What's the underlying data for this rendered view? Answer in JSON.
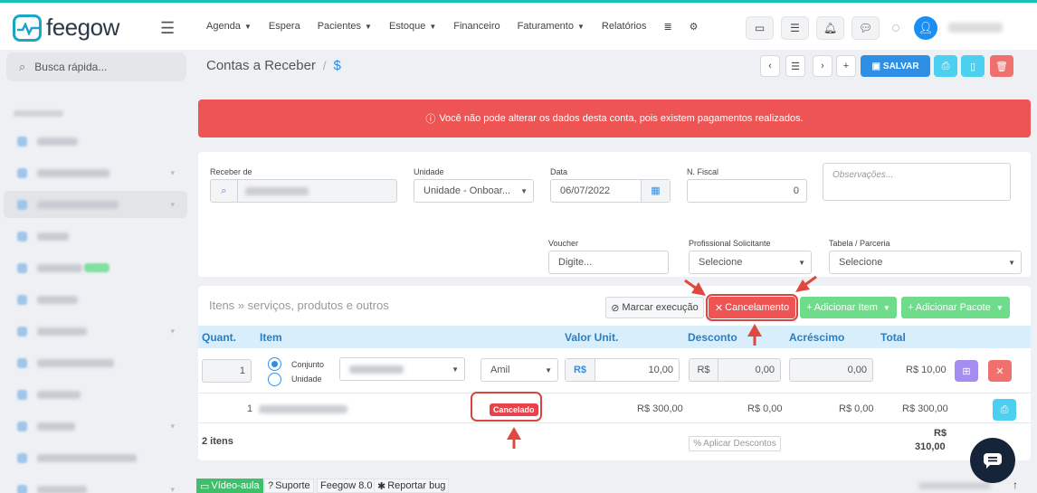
{
  "app": {
    "brand": "feegow"
  },
  "nav": [
    {
      "label": "Agenda",
      "dropdown": true
    },
    {
      "label": "Espera",
      "dropdown": false
    },
    {
      "label": "Pacientes",
      "dropdown": true
    },
    {
      "label": "Estoque",
      "dropdown": true
    },
    {
      "label": "Financeiro",
      "dropdown": false
    },
    {
      "label": "Faturamento",
      "dropdown": true
    },
    {
      "label": "Relatórios",
      "dropdown": false
    }
  ],
  "search": {
    "placeholder": "Busca rápida..."
  },
  "page": {
    "title": "Contas a Receber",
    "separator": "/",
    "symbol": "$",
    "save_label": "SALVAR"
  },
  "alert": {
    "message": "Você não pode alterar os dados desta conta, pois existem pagamentos realizados."
  },
  "form": {
    "receber_de": {
      "label": "Receber de"
    },
    "unidade": {
      "label": "Unidade",
      "value": "Unidade - Onboar..."
    },
    "data": {
      "label": "Data",
      "value": "06/07/2022"
    },
    "nfiscal": {
      "label": "N. Fiscal",
      "value": "0"
    },
    "observacoes": {
      "placeholder": "Observações..."
    },
    "voucher": {
      "label": "Voucher",
      "placeholder": "Digite..."
    },
    "profissional": {
      "label": "Profissional Solicitante",
      "value": "Selecione"
    },
    "tabela": {
      "label": "Tabela / Parceria",
      "value": "Selecione"
    }
  },
  "items": {
    "title": "Itens » serviços, produtos e outros",
    "marcar_label": "Marcar execução",
    "cancel_label": "Cancelamento",
    "add_item_label": "Adicionar Item",
    "add_pacote_label": "Adicionar Pacote",
    "columns": [
      "Quant.",
      "Item",
      "Valor Unit.",
      "Desconto",
      "Acréscimo",
      "Total"
    ],
    "new_row": {
      "quant": "1",
      "conjunto": "Conjunto",
      "unidade": "Unidade",
      "convenio": "Amil",
      "currency": "R$",
      "valor": "10,00",
      "desc_currency": "R$",
      "desconto": "0,00",
      "acrescimo": "0,00",
      "total": "R$ 10,00"
    },
    "row": {
      "quant": "1",
      "status": "Cancelado",
      "valor": "R$ 300,00",
      "desconto": "R$ 0,00",
      "acrescimo": "R$ 0,00",
      "total": "R$ 300,00"
    },
    "count_label": "2 itens",
    "aplicar_label": "Aplicar Descontos",
    "grand_total_currency": "R$",
    "grand_total_value": "310,00"
  },
  "footer": {
    "video": "Vídeo-aula",
    "suporte": "Suporte",
    "version": "Feegow 8.0",
    "bug": "Reportar bug"
  },
  "colors": {
    "accent": "#2e8fe4",
    "danger": "#ef5455",
    "success": "#6fdc8c",
    "annotation": "#d9453d"
  }
}
